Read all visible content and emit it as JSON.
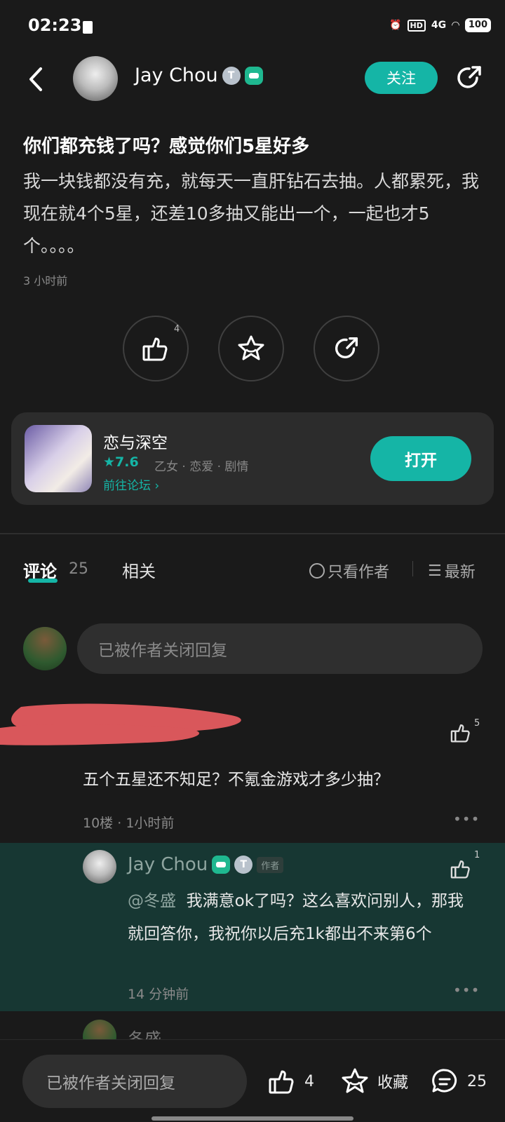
{
  "status_bar": {
    "time": "02:23",
    "network": "4G",
    "hd": "HD",
    "battery": "100"
  },
  "header": {
    "username": "Jay Chou",
    "badge_t": "T",
    "follow_label": "关注"
  },
  "post": {
    "title": "你们都充钱了吗？感觉你们5星好多",
    "body": "我一块钱都没有充，就每天一直肝钻石去抽。人都累死，我现在就4个5星，还差10多抽又能出一个，一起也才5个。。。。",
    "time": "3 小时前",
    "like_count": "4"
  },
  "app_card": {
    "name": "恋与深空",
    "rating": "7.6",
    "tags": "乙女 · 恋爱 · 剧情",
    "forum_link": "前往论坛",
    "open_label": "打开"
  },
  "tabs": {
    "comments_label": "评论",
    "comments_count": "25",
    "related_label": "相关",
    "only_author": "只看作者",
    "sort": "最新"
  },
  "reply_input_placeholder": "已被作者关闭回复",
  "comments": [
    {
      "text": "五个五星还不知足？不氪金游戏才多少抽？",
      "floor": "10楼",
      "time": "1小时前",
      "like_count": "5",
      "replies": [
        {
          "username": "Jay Chou",
          "author_tag": "作者",
          "mention": "@冬盛",
          "text": "我满意ok了吗？这么喜欢问别人，那我就回答你，我祝你以后充1k都出不来第6个",
          "time": "14 分钟前",
          "like_count": "1"
        }
      ]
    },
    {
      "username": "冬盛"
    }
  ],
  "bottom_bar": {
    "input_placeholder": "已被作者关闭回复",
    "like_count": "4",
    "favorite_label": "收藏",
    "comment_count": "25"
  },
  "colors": {
    "accent": "#15b5a6",
    "background": "#1a1a1a",
    "reply_highlight": "#173733"
  }
}
